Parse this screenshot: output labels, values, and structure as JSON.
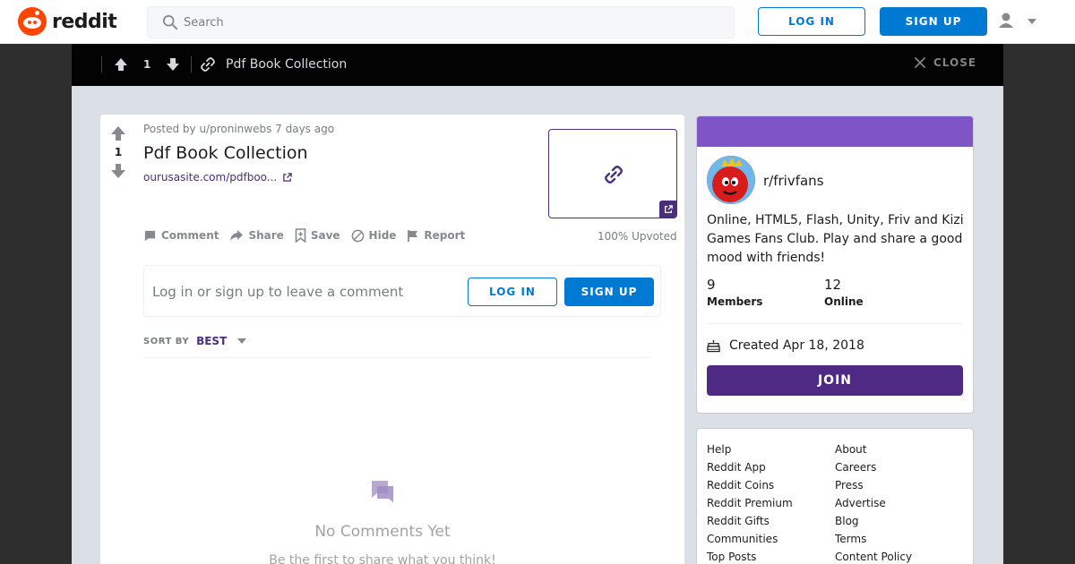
{
  "header": {
    "logo_text": "reddit",
    "search_placeholder": "Search",
    "login_label": "LOG IN",
    "signup_label": "SIGN UP"
  },
  "topbar": {
    "score": "1",
    "title": "Pdf Book Collection",
    "close_label": "CLOSE"
  },
  "post": {
    "meta": "Posted by u/proninwebs 7 days ago",
    "score": "1",
    "title": "Pdf Book Collection",
    "link_text": "ourusasite.com/pdfboo...",
    "actions": [
      "Comment",
      "Share",
      "Save",
      "Hide",
      "Report"
    ],
    "upvoted": "100% Upvoted",
    "comment_prompt": "Log in or sign up to leave a comment",
    "login_label": "LOG IN",
    "signup_label": "SIGN UP",
    "sort_label": "SORT BY",
    "sort_value": "BEST",
    "empty_title": "No Comments Yet",
    "empty_sub": "Be the first to share what you think!"
  },
  "sidebar": {
    "subreddit": "r/frivfans",
    "description": "Online, HTML5, Flash, Unity, Friv and Kizi Games Fans Club. Play and share a good mood with friends!",
    "members_count": "9",
    "members_label": "Members",
    "online_count": "12",
    "online_label": "Online",
    "created": "Created Apr 18, 2018",
    "join_label": "JOIN",
    "banner_color": "#7f54c4",
    "join_color": "#4e2a84"
  },
  "footer_links": {
    "col1": [
      "Help",
      "Reddit App",
      "Reddit Coins",
      "Reddit Premium",
      "Reddit Gifts",
      "Communities",
      "Top Posts"
    ],
    "col2": [
      "About",
      "Careers",
      "Press",
      "Advertise",
      "Blog",
      "Terms",
      "Content Policy"
    ]
  },
  "colors": {
    "accent": "#0079d3",
    "brand": "#ff4500",
    "link": "#4a2f7d"
  }
}
